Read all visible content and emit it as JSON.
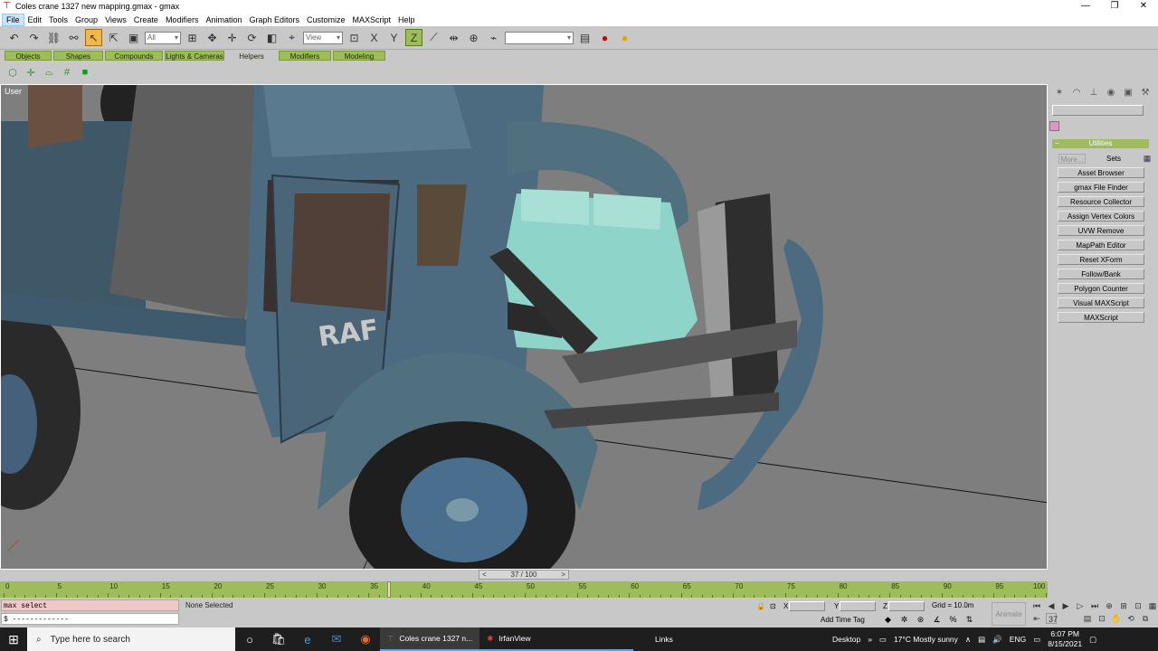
{
  "window": {
    "title": "Coles crane 1327 new mapping.gmax - gmax",
    "icon": "gmax-app-icon",
    "controls": {
      "minimize": "—",
      "restore": "❐",
      "close": "✕"
    }
  },
  "menu": [
    "File",
    "Edit",
    "Tools",
    "Group",
    "Views",
    "Create",
    "Modifiers",
    "Animation",
    "Graph Editors",
    "Customize",
    "MAXScript",
    "Help"
  ],
  "toolbar": {
    "selection_filter": "All",
    "reference_coord": "View",
    "named_selection": ""
  },
  "tabs": [
    {
      "label": "Objects",
      "active": false
    },
    {
      "label": "Shapes",
      "active": false
    },
    {
      "label": "Compounds",
      "active": false
    },
    {
      "label": "Lights & Cameras",
      "active": false
    },
    {
      "label": "Helpers",
      "active": true
    },
    {
      "label": "Modifiers",
      "active": false
    },
    {
      "label": "Modeling",
      "active": false
    }
  ],
  "viewport": {
    "label": "User",
    "decal_text": "RAF",
    "background": "#7e7e7e"
  },
  "command_panel": {
    "rollout_title": "Utilities",
    "more_label": "More...",
    "sets_label": "Sets",
    "utilities": [
      "Asset Browser",
      "gmax File Finder",
      "Resource Collector",
      "Assign Vertex Colors",
      "UVW Remove",
      "MapPath Editor",
      "Reset XForm",
      "Follow/Bank",
      "Polygon Counter",
      "Visual MAXScript",
      "MAXScript"
    ],
    "color_swatch": "#e890c8"
  },
  "timeline": {
    "slider_text": "37 / 100",
    "current_frame": 37,
    "total_frames": 100,
    "labels": [
      "0",
      "5",
      "10",
      "15",
      "20",
      "25",
      "30",
      "35",
      "40",
      "45",
      "50",
      "55",
      "60",
      "65",
      "70",
      "75",
      "80",
      "85",
      "90",
      "95",
      "100"
    ]
  },
  "status": {
    "maxscript_listener": "max select",
    "maxscript_output": "$ -------------",
    "selection_status": "None Selected",
    "x_label": "X",
    "y_label": "Y",
    "z_label": "Z",
    "grid": "Grid = 10.0m",
    "add_time_tag": "Add Time Tag",
    "animate_label": "Animate",
    "frame_field": "37"
  },
  "taskbar": {
    "search_placeholder": "Type here to search",
    "apps": [
      {
        "label": "Coles crane 1327 n...",
        "active": true
      },
      {
        "label": "IrfanView",
        "active": false
      }
    ],
    "links": "Links",
    "desktop": "Desktop",
    "weather": "17°C  Mostly sunny",
    "language": "ENG",
    "time": "6:07 PM",
    "date": "8/15/2021"
  },
  "colors": {
    "accent_green": "#9ebc5a",
    "select_orange": "#f0b84a",
    "engine_teal": "#8fd4c8",
    "truck_blue": "#4a6a80"
  }
}
